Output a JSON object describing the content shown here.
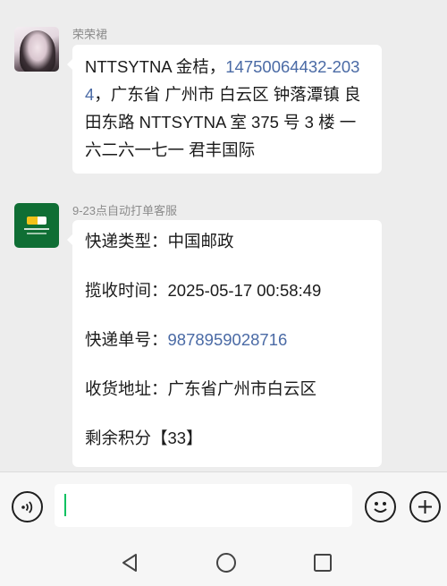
{
  "messages": [
    {
      "sender": "荣荣裙",
      "avatar_icon": "woman-portrait-avatar",
      "text_prefix": "NTTSYTNA 金桔，",
      "phone": "14750064432-2034",
      "text_suffix": "，广东省 广州市 白云区 钟落潭镇 良田东路 NTTSYTNA 室 375 号 3 楼 一六二六一七一 君丰国际"
    },
    {
      "sender": "9-23点自动打单客服",
      "avatar_icon": "china-post-logo-avatar",
      "courier_type": {
        "label": "快递类型：",
        "value": "中国邮政"
      },
      "pickup_time": {
        "label": "揽收时间：",
        "value": "2025-05-17 00:58:49"
      },
      "tracking_no": {
        "label": "快递单号：",
        "value": "9878959028716"
      },
      "address": {
        "label": "收货地址：",
        "value": "广东省广州市白云区"
      },
      "points": "剩余积分【33】"
    }
  ],
  "input_bar": {
    "placeholder": "",
    "voice_icon": "voice-input-icon",
    "emoji_icon": "emoji-icon",
    "plus_icon": "plus-icon",
    "caret_color": "#07c160"
  },
  "nav_bar": {
    "back_icon": "back-triangle-icon",
    "home_icon": "home-circle-icon",
    "recent_icon": "recent-apps-square-icon"
  },
  "colors": {
    "background": "#ededed",
    "bubble": "#ffffff",
    "link": "#4a6aa5",
    "sender": "#8c8c8c"
  }
}
